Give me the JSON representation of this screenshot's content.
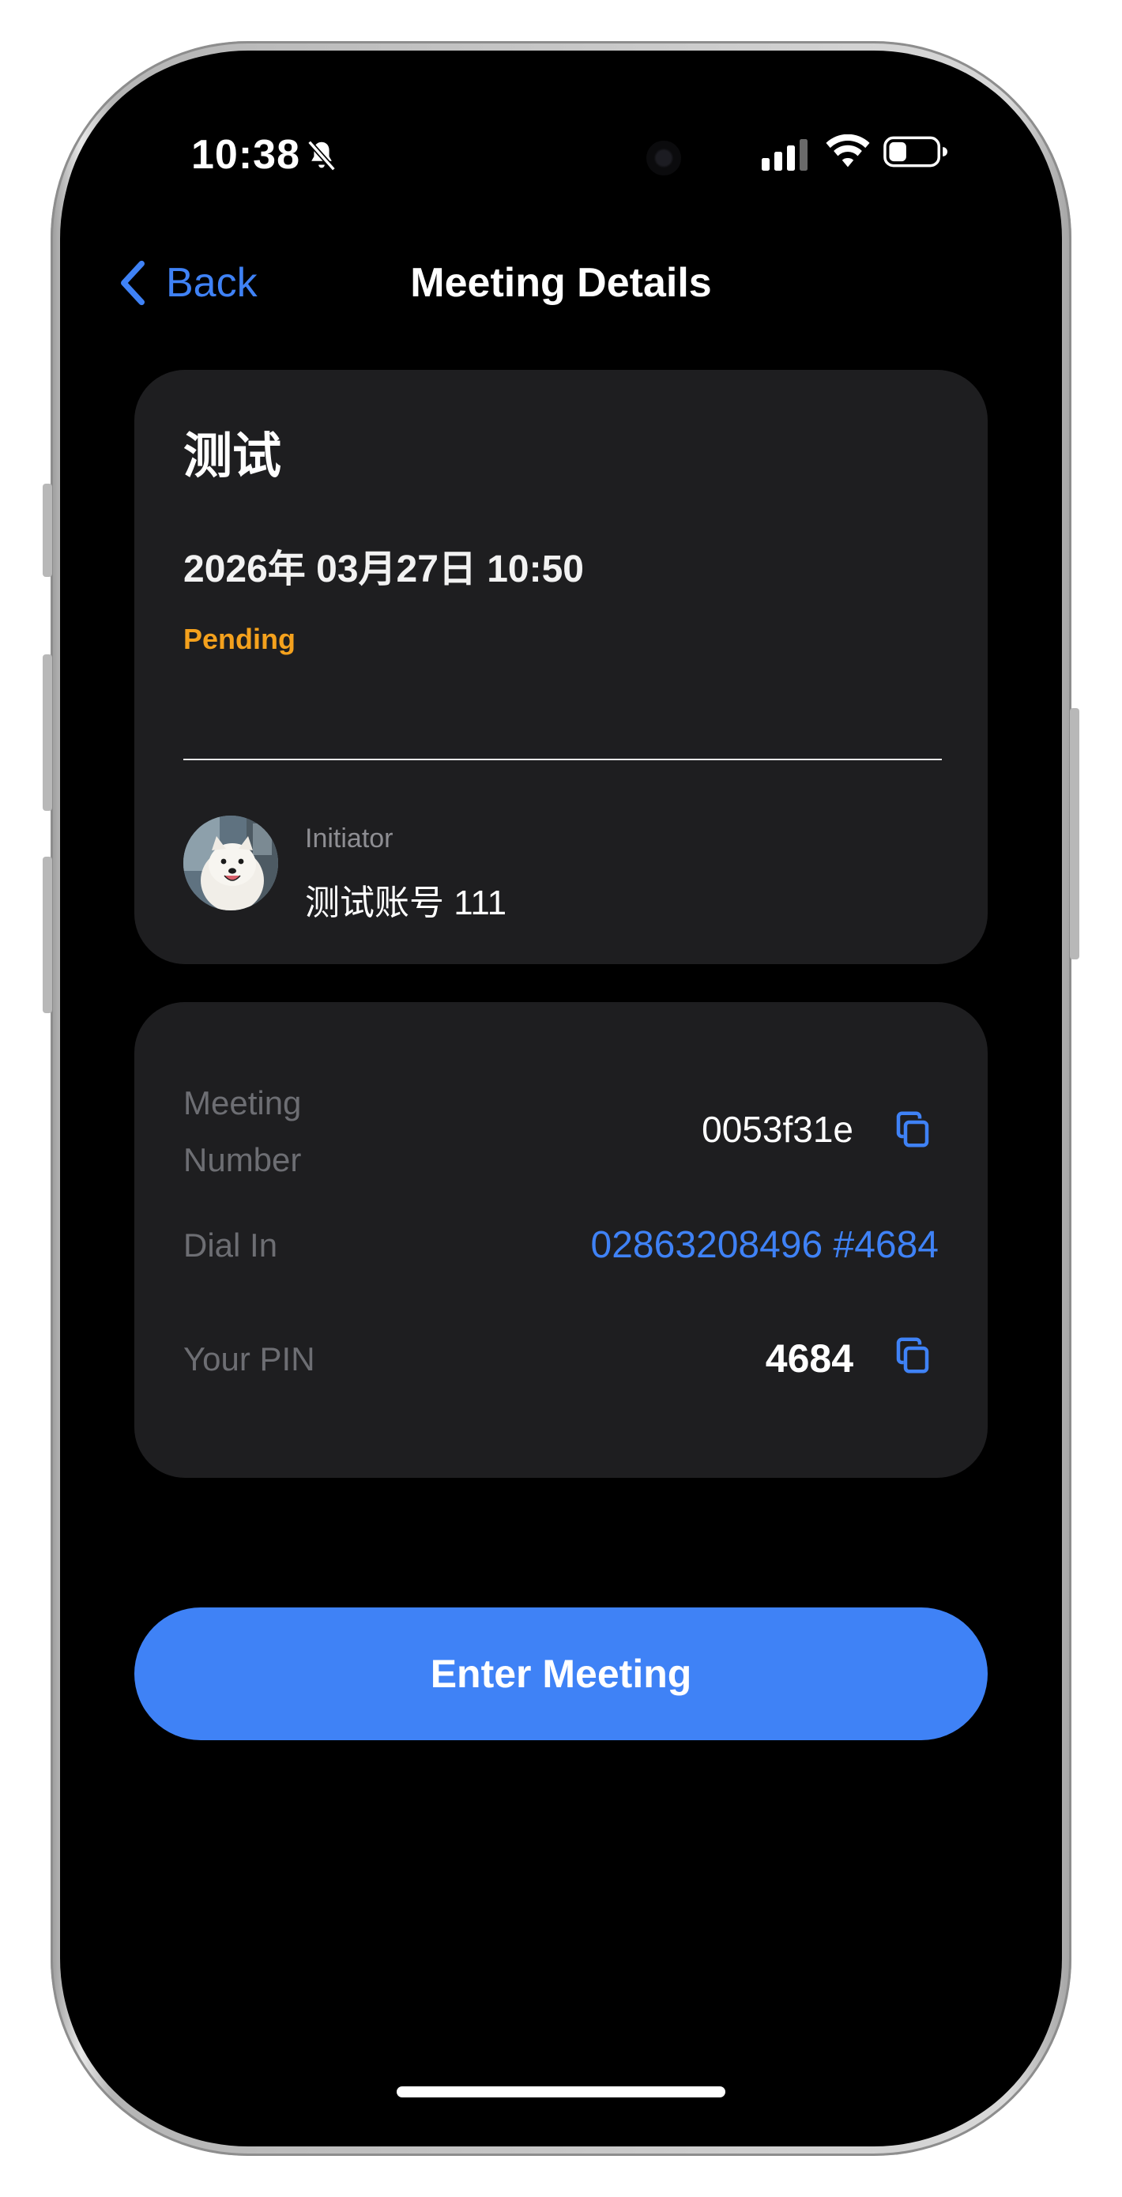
{
  "status_bar": {
    "time": "10:38",
    "icons": [
      "bell-slash-icon",
      "signal-icon",
      "wifi-icon",
      "battery-icon"
    ]
  },
  "nav": {
    "back_label": "Back",
    "title": "Meeting Details"
  },
  "meeting": {
    "title": "测试",
    "datetime": "2026年 03月27日 10:50",
    "status": "Pending",
    "initiator_label": "Initiator",
    "initiator_name": "测试账号 111"
  },
  "info": {
    "meeting_number_label_line1": "Meeting",
    "meeting_number_label_line2": "Number",
    "meeting_number": "0053f31e",
    "dial_in_label": "Dial In",
    "dial_in_value": "02863208496 #4684",
    "pin_label": "Your PIN",
    "pin_value": "4684"
  },
  "actions": {
    "enter_label": "Enter Meeting"
  },
  "colors": {
    "accent": "#3f82f6",
    "pending": "#f4a11d",
    "card_bg": "#1e1e20",
    "background": "#000000"
  }
}
